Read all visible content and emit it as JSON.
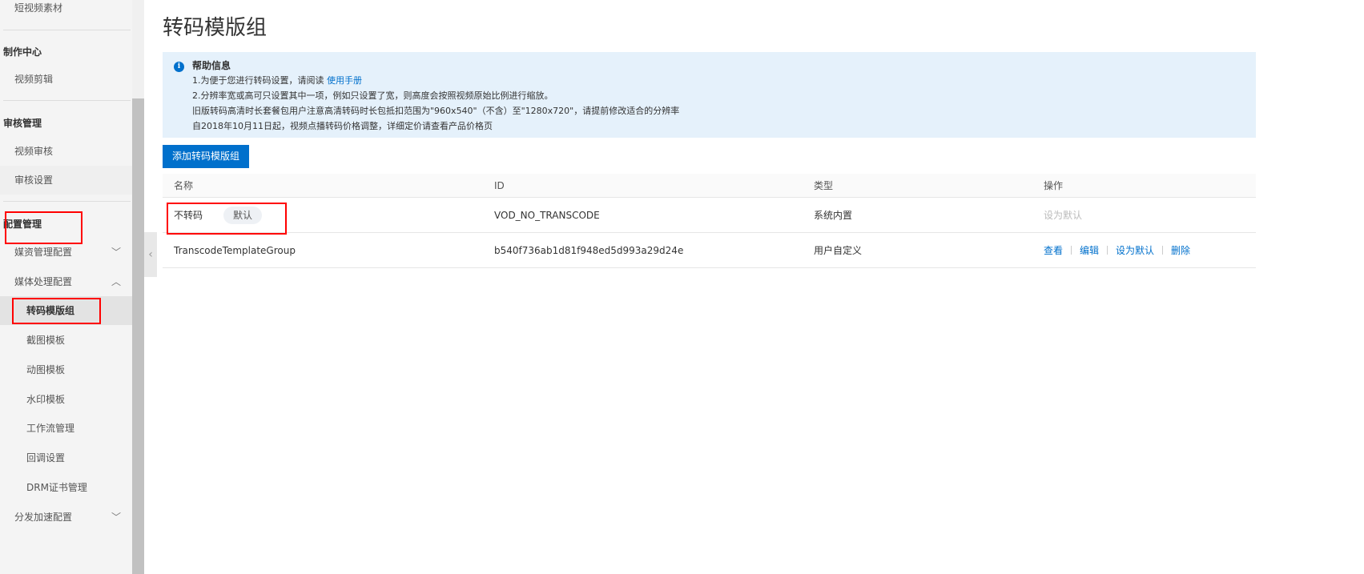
{
  "sidebar": {
    "items": {
      "short_video": "短视频素材",
      "video_edit": "视频剪辑",
      "video_review": "视频审核",
      "review_settings": "审核设置",
      "media_asset_config": "媒资管理配置",
      "media_process_config": "媒体处理配置",
      "transcode_group": "转码模版组",
      "snapshot_template": "截图模板",
      "gif_template": "动图模板",
      "watermark_template": "水印模板",
      "workflow": "工作流管理",
      "callback": "回调设置",
      "drm": "DRM证书管理",
      "cdn_config": "分发加速配置"
    },
    "groups": {
      "production": "制作中心",
      "review": "审核管理",
      "config": "配置管理"
    }
  },
  "page": {
    "title": "转码模版组"
  },
  "help": {
    "title": "帮助信息",
    "line1_prefix": "1.为便于您进行转码设置，请阅读 ",
    "line1_link": "使用手册",
    "line2": "2.分辨率宽或高可只设置其中一项，例如只设置了宽，则高度会按照视频原始比例进行缩放。",
    "line3": "旧版转码高清时长套餐包用户注意高清转码时长包抵扣范围为\"960x540\"（不含）至\"1280x720\"，请提前修改适合的分辨率",
    "line4": "自2018年10月11日起，视频点播转码价格调整，详细定价请查看产品价格页"
  },
  "toolbar": {
    "add_label": "添加转码模版组"
  },
  "table": {
    "headers": [
      "名称",
      "ID",
      "类型",
      "操作"
    ],
    "rows": [
      {
        "name": "不转码",
        "tag": "默认",
        "id": "VOD_NO_TRANSCODE",
        "type": "系统内置",
        "actions": [
          "设为默认"
        ]
      },
      {
        "name": "TranscodeTemplateGroup",
        "id": "b540f736ab1d81f948ed5d993a29d24e",
        "type": "用户自定义",
        "actions": [
          "查看",
          "编辑",
          "设为默认",
          "删除"
        ]
      }
    ]
  },
  "colors": {
    "accent": "#0070cc",
    "highlight": "#ff0000",
    "info_bg": "#e5f1fb"
  }
}
